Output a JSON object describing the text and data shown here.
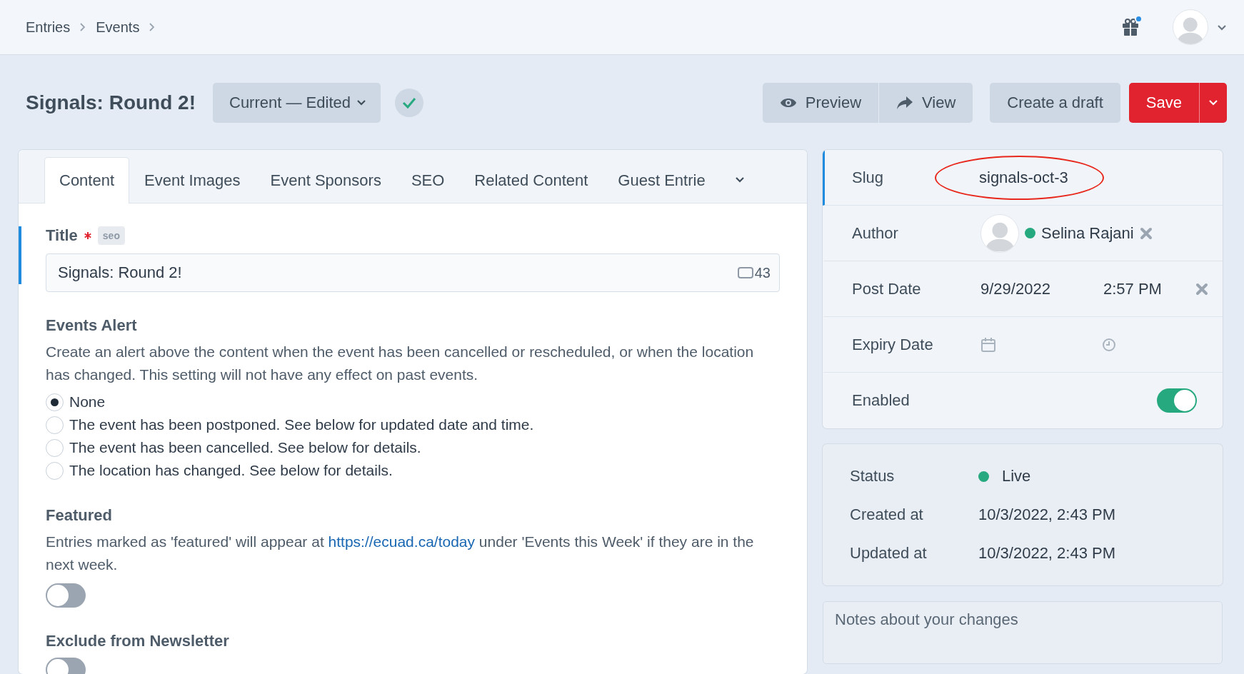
{
  "breadcrumbs": [
    "Entries",
    "Events"
  ],
  "header": {
    "notification_dot": true
  },
  "entry": {
    "title": "Signals: Round 2!",
    "revision": "Current — Edited",
    "saved": true
  },
  "actions": {
    "preview": "Preview",
    "view": "View",
    "draft": "Create a draft",
    "save": "Save"
  },
  "tabs": [
    {
      "label": "Content",
      "selected": true
    },
    {
      "label": "Event Images",
      "selected": false
    },
    {
      "label": "Event Sponsors",
      "selected": false
    },
    {
      "label": "SEO",
      "selected": false
    },
    {
      "label": "Related Content",
      "selected": false
    },
    {
      "label": "Guest Entrie",
      "selected": false
    }
  ],
  "title_field": {
    "label": "Title",
    "required": true,
    "badge": "seo",
    "value": "Signals: Round 2!",
    "count": "43"
  },
  "events_alert": {
    "label": "Events Alert",
    "instructions": "Create an alert above the content when the event has been cancelled or rescheduled, or when the location has changed. This setting will not have any effect on past events.",
    "options": [
      {
        "label": "None",
        "selected": true
      },
      {
        "label": "The event has been postponed. See below for updated date and time.",
        "selected": false
      },
      {
        "label": "The event has been cancelled. See below for details.",
        "selected": false
      },
      {
        "label": "The location has changed. See below for details.",
        "selected": false
      }
    ]
  },
  "featured": {
    "label": "Featured",
    "text_before": "Entries marked as 'featured' will appear at ",
    "link": "https://ecuad.ca/today",
    "text_after": " under 'Events this Week' if they are in the next week.",
    "on": false
  },
  "exclude_newsletter": {
    "label": "Exclude from Newsletter",
    "on": false
  },
  "meta": {
    "slug_label": "Slug",
    "slug": "signals-oct-3",
    "author_label": "Author",
    "author": {
      "name": "Selina Rajani",
      "color": "#27a97f"
    },
    "post_date_label": "Post Date",
    "post_date": "9/29/2022",
    "post_time": "2:57 PM",
    "expiry_label": "Expiry Date",
    "enabled_label": "Enabled",
    "enabled": true
  },
  "status": [
    {
      "label": "Status",
      "value": "Live",
      "color": "#27a97f"
    },
    {
      "label": "Created at",
      "value": "10/3/2022, 2:43 PM"
    },
    {
      "label": "Updated at",
      "value": "10/3/2022, 2:43 PM"
    }
  ],
  "notes": {
    "placeholder": "Notes about your changes"
  }
}
